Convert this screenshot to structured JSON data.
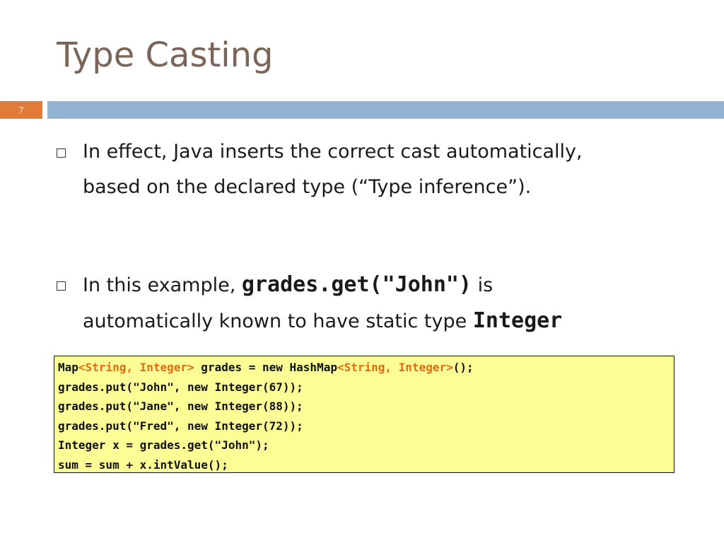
{
  "slide": {
    "title": "Type Casting",
    "number": "7"
  },
  "bullets": [
    {
      "line1": "In effect, Java inserts the correct cast automatically,",
      "line2": "based on the declared type (“Type inference”)."
    },
    {
      "prefix": "In this example, ",
      "code1": "grades.get(\"John\")",
      "suffix": " is",
      "line2_text": "automatically known to have static type ",
      "code2": "Integer"
    }
  ],
  "code": {
    "line1": {
      "a": "Map",
      "b": "<String, Integer>",
      "c": " grades = new HashMap",
      "d": "<String, Integer>",
      "e": "();"
    },
    "line2": "grades.put(\"John\", new Integer(67));",
    "line3": "grades.put(\"Jane\", new Integer(88));",
    "line4": "grades.put(\"Fred\", new Integer(72));",
    "line5": "Integer x = grades.get(\"John\");",
    "line6": "sum = sum + x.intValue();"
  },
  "colors": {
    "title": "#7b6458",
    "slide_number_box": "#e07b39",
    "band": "#93b3d3",
    "code_background": "#fdfd96",
    "generic_highlight": "#e36a10"
  }
}
